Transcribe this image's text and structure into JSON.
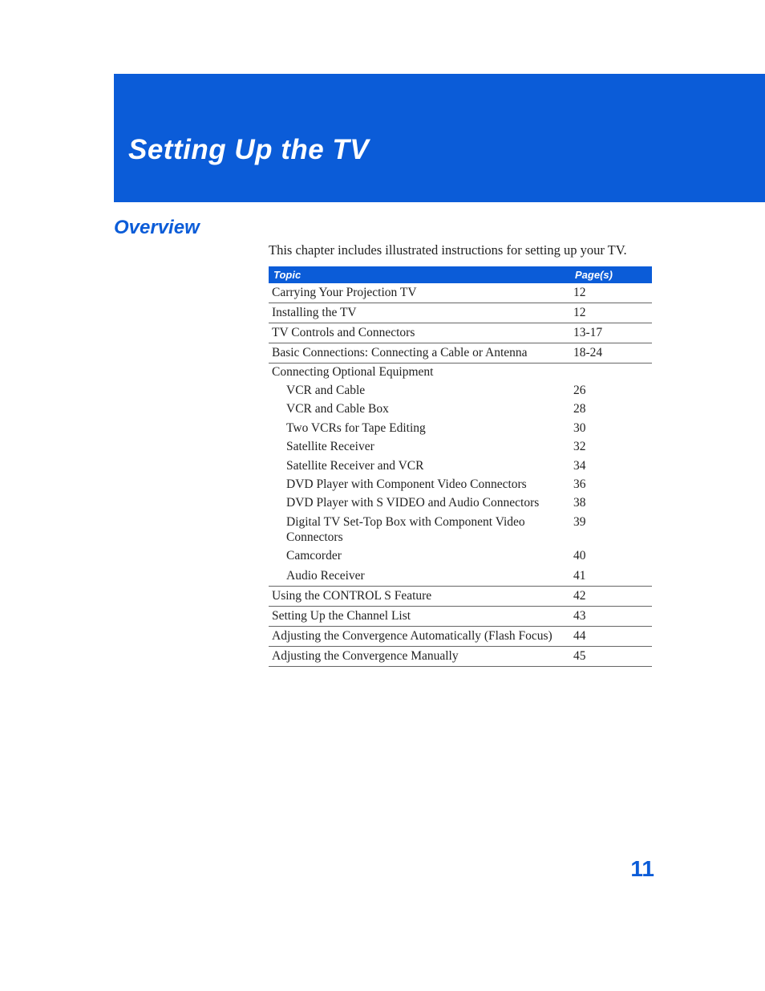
{
  "chapter_title": "Setting Up the TV",
  "overview_heading": "Overview",
  "intro_text": "This chapter includes illustrated instructions for setting up your TV.",
  "table": {
    "col_topic": "Topic",
    "col_pages": "Page(s)",
    "rows": [
      {
        "topic": "Carrying Your Projection TV",
        "pages": "12"
      },
      {
        "topic": "Installing the TV",
        "pages": "12"
      },
      {
        "topic": "TV Controls and Connectors",
        "pages": "13-17"
      },
      {
        "topic": "Basic Connections: Connecting a Cable or Antenna",
        "pages": "18-24"
      },
      {
        "topic": "Connecting Optional Equipment",
        "pages": ""
      },
      {
        "topic": "VCR and Cable",
        "pages": "26"
      },
      {
        "topic": "VCR and Cable Box",
        "pages": "28"
      },
      {
        "topic": "Two VCRs for Tape Editing",
        "pages": "30"
      },
      {
        "topic": "Satellite Receiver",
        "pages": "32"
      },
      {
        "topic": "Satellite Receiver and VCR",
        "pages": "34"
      },
      {
        "topic": "DVD Player with Component Video Connectors",
        "pages": "36"
      },
      {
        "topic": "DVD Player with S VIDEO and Audio Connectors",
        "pages": "38"
      },
      {
        "topic": "Digital TV Set-Top Box with Component Video Connectors",
        "pages": "39"
      },
      {
        "topic": "Camcorder",
        "pages": "40"
      },
      {
        "topic": "Audio Receiver",
        "pages": "41"
      },
      {
        "topic": "Using the CONTROL S Feature",
        "pages": "42"
      },
      {
        "topic": "Setting Up the Channel List",
        "pages": "43"
      },
      {
        "topic": "Adjusting the Convergence Automatically (Flash Focus)",
        "pages": "44"
      },
      {
        "topic": "Adjusting the Convergence Manually",
        "pages": "45"
      }
    ]
  },
  "page_number": "11"
}
